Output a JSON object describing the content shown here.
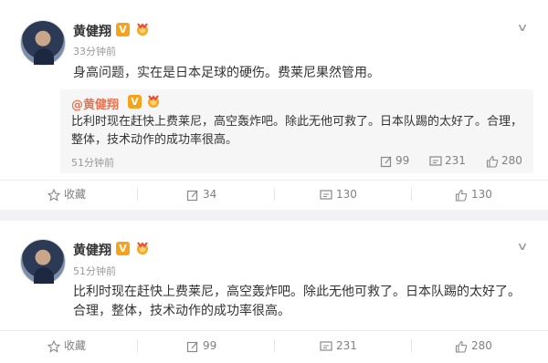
{
  "post1": {
    "author": "黄健翔",
    "verified_badge": "V",
    "time": "33分钟前",
    "text": "身高问题，实在是日本足球的硬伤。费莱尼果然管用。",
    "quoted": {
      "author": "@黄健翔",
      "verified_badge": "V",
      "text": "比利时现在赶快上费莱尼，高空轰炸吧。除此无他可救了。日本队踢的太好了。合理，整体，技术动作的成功率很高。",
      "time": "51分钟前",
      "reposts": "99",
      "comments": "231",
      "likes": "280"
    },
    "actions": {
      "favorite": "收藏",
      "reposts": "34",
      "comments": "130",
      "likes": "130"
    }
  },
  "post2": {
    "author": "黄健翔",
    "verified_badge": "V",
    "time": "51分钟前",
    "text_line1": "比利时现在赶快上费莱尼，高空轰炸吧。除此无他可救了。日本队踢的太好了。",
    "text_line2": "合理，整体，技术动作的成功率很高。",
    "actions": {
      "favorite": "收藏",
      "reposts": "99",
      "comments": "231",
      "likes": "280"
    }
  },
  "colors": {
    "accent": "#eb7350",
    "verified": "#f7a21b",
    "muted": "#808080"
  }
}
